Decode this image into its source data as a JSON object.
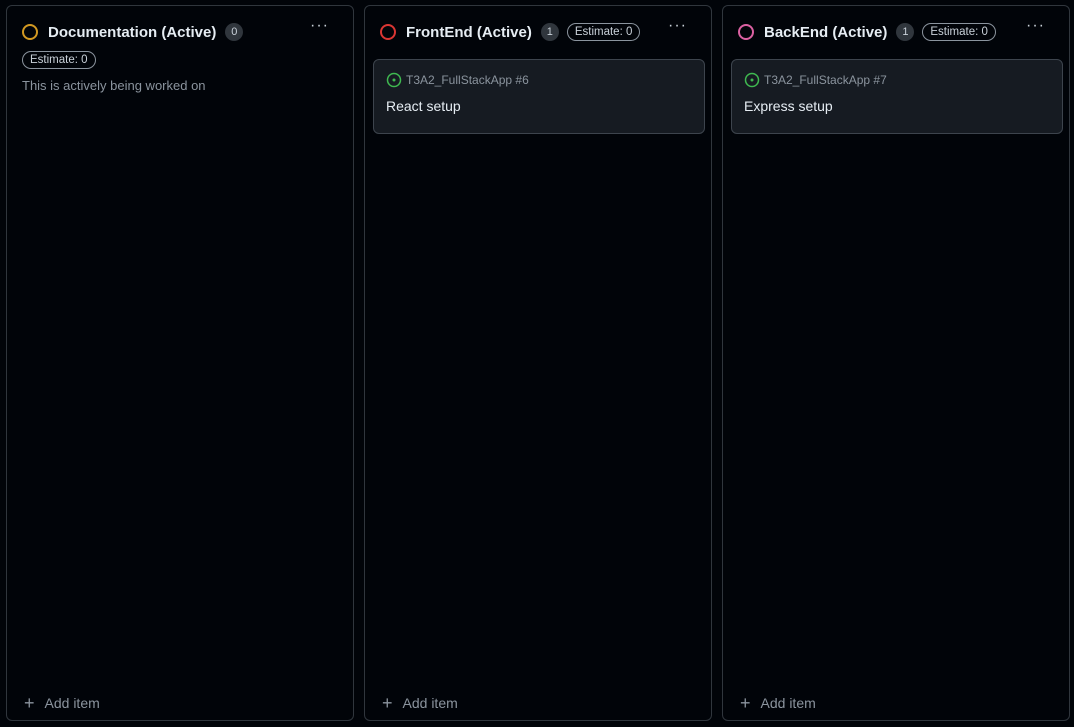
{
  "columns": [
    {
      "title": "Documentation (Active)",
      "count": "0",
      "estimate": "Estimate: 0",
      "description": "This is actively being worked on",
      "status_color": "#d29922",
      "more_icon": "ellipsis-icon",
      "add_label": "Add item"
    },
    {
      "title": "FrontEnd (Active)",
      "count": "1",
      "estimate": "Estimate: 0",
      "status_color": "#da3633",
      "more_icon": "ellipsis-icon",
      "add_label": "Add item",
      "cards": [
        {
          "ref": "T3A2_FullStackApp #6",
          "title": "React setup",
          "icon": "issue-open-icon",
          "icon_color": "#3fb950"
        }
      ]
    },
    {
      "title": "BackEnd (Active)",
      "count": "1",
      "estimate": "Estimate: 0",
      "status_color": "#db61a2",
      "more_icon": "ellipsis-icon",
      "add_label": "Add item",
      "cards": [
        {
          "ref": "T3A2_FullStackApp #7",
          "title": "Express setup",
          "icon": "issue-open-icon",
          "icon_color": "#3fb950"
        }
      ]
    }
  ]
}
